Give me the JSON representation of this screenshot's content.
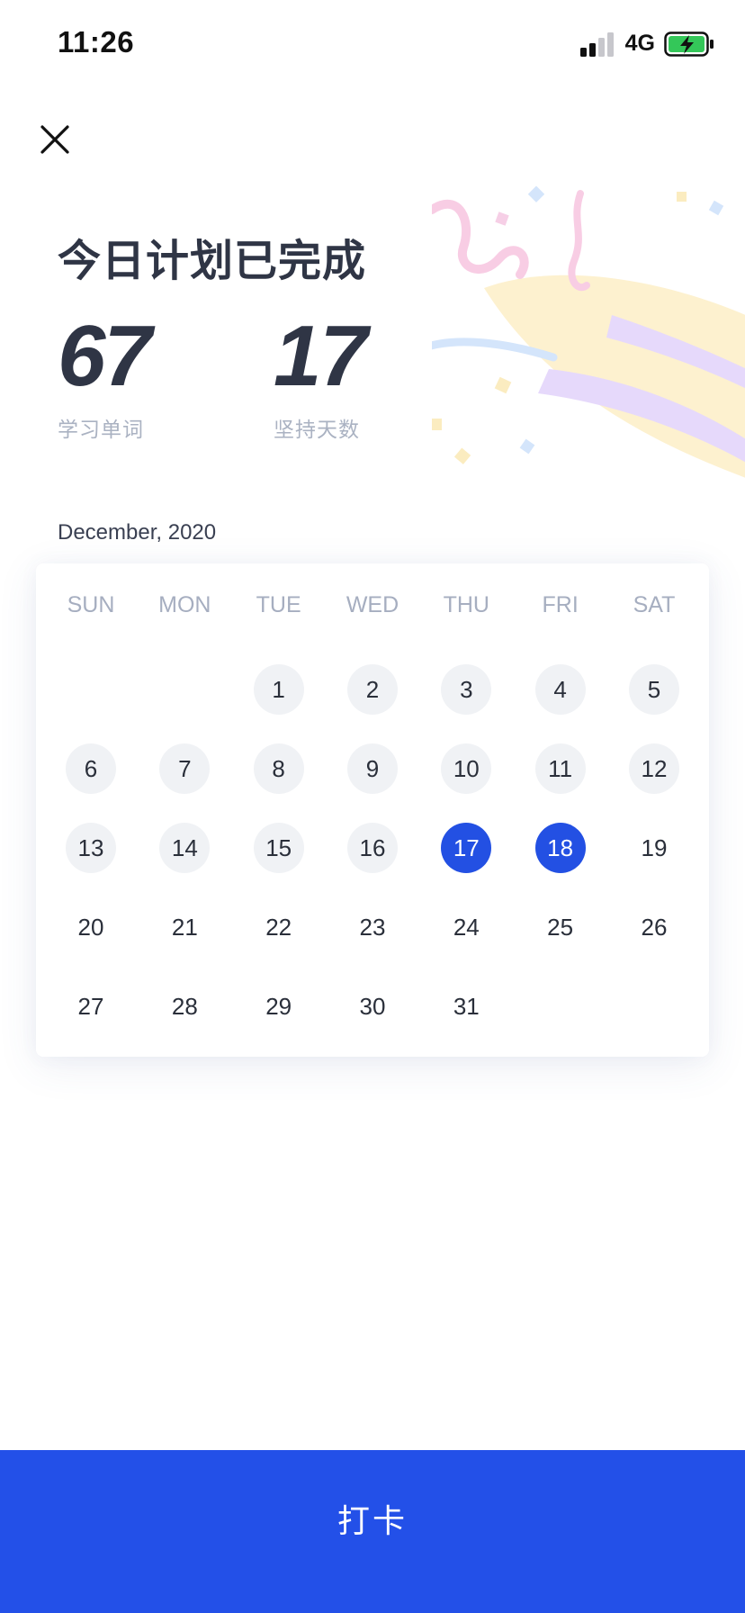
{
  "status_bar": {
    "time": "11:26",
    "network": "4G",
    "signal_icon": "cellular-signal-icon",
    "battery_icon": "battery-charging-icon",
    "battery_color": "#34c759"
  },
  "header": {
    "close_icon": "close-icon",
    "title": "今日计划已完成",
    "decoration_icon": "party-popper-confetti-icon"
  },
  "stats": [
    {
      "value": "67",
      "label": "学习单词"
    },
    {
      "value": "17",
      "label": "坚持天数"
    }
  ],
  "calendar": {
    "month_label": "December, 2020",
    "weekdays": [
      "SUN",
      "MON",
      "TUE",
      "WED",
      "THU",
      "FRI",
      "SAT"
    ],
    "leading_blanks": 2,
    "days": [
      {
        "label": "1",
        "status": "studied"
      },
      {
        "label": "2",
        "status": "studied"
      },
      {
        "label": "3",
        "status": "studied"
      },
      {
        "label": "4",
        "status": "studied"
      },
      {
        "label": "5",
        "status": "studied"
      },
      {
        "label": "6",
        "status": "studied"
      },
      {
        "label": "7",
        "status": "studied"
      },
      {
        "label": "8",
        "status": "studied"
      },
      {
        "label": "9",
        "status": "studied"
      },
      {
        "label": "10",
        "status": "studied"
      },
      {
        "label": "11",
        "status": "studied"
      },
      {
        "label": "12",
        "status": "studied"
      },
      {
        "label": "13",
        "status": "studied"
      },
      {
        "label": "14",
        "status": "studied"
      },
      {
        "label": "15",
        "status": "studied"
      },
      {
        "label": "16",
        "status": "studied"
      },
      {
        "label": "17",
        "status": "checked"
      },
      {
        "label": "18",
        "status": "checked"
      },
      {
        "label": "19",
        "status": "none"
      },
      {
        "label": "20",
        "status": "none"
      },
      {
        "label": "21",
        "status": "none"
      },
      {
        "label": "22",
        "status": "none"
      },
      {
        "label": "23",
        "status": "none"
      },
      {
        "label": "24",
        "status": "none"
      },
      {
        "label": "25",
        "status": "none"
      },
      {
        "label": "26",
        "status": "none"
      },
      {
        "label": "27",
        "status": "none"
      },
      {
        "label": "28",
        "status": "none"
      },
      {
        "label": "29",
        "status": "none"
      },
      {
        "label": "30",
        "status": "none"
      },
      {
        "label": "31",
        "status": "none"
      }
    ]
  },
  "checkin_button": {
    "label": "打卡"
  },
  "colors": {
    "accent": "#2350e8",
    "checked_day": "#2350e3",
    "studied_day": "#f0f2f5",
    "title_text": "#2f3545",
    "muted_text": "#aab2c2"
  }
}
